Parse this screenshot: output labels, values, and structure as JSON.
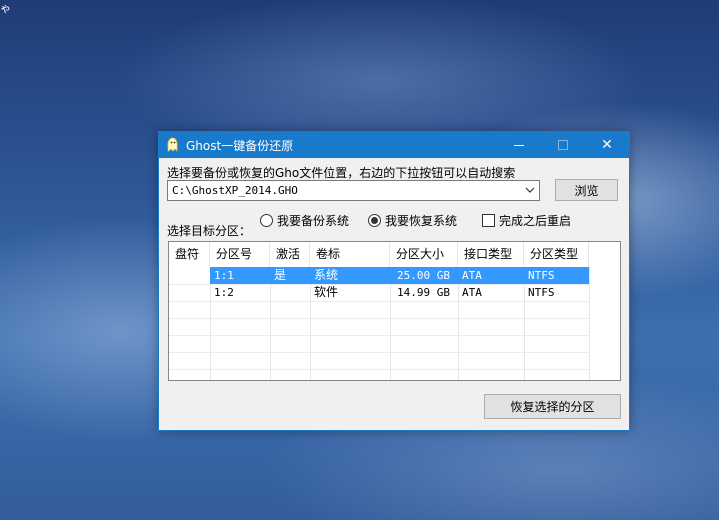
{
  "desktop": {
    "corner_glyph": "ゃ"
  },
  "window": {
    "title": "Ghost一键备份还原",
    "icon": "ghost-app-icon",
    "controls": {
      "minimize": "minimize-icon",
      "maximize": "maximize-icon",
      "close": "close-icon",
      "close_glyph": "✕"
    }
  },
  "path": {
    "label": "选择要备份或恢复的Gho文件位置，右边的下拉按钮可以自动搜索",
    "value": "C:\\GhostXP_2014.GHO",
    "browse_label": "浏览"
  },
  "target": {
    "label": "选择目标分区：",
    "options": [
      {
        "label": "我要备份系统",
        "selected": false
      },
      {
        "label": "我要恢复系统",
        "selected": true
      }
    ],
    "reboot_label": "完成之后重启",
    "reboot_checked": false
  },
  "table": {
    "columns": [
      "盘符",
      "分区号",
      "激活",
      "卷标",
      "分区大小",
      "接口类型",
      "分区类型"
    ],
    "rows": [
      {
        "drive": "",
        "partition": "1:1",
        "active": "是",
        "label": "系统",
        "size": "25.00 GB",
        "interface": "ATA",
        "type": "NTFS",
        "selected": true
      },
      {
        "drive": "",
        "partition": "1:2",
        "active": "",
        "label": "软件",
        "size": "14.99 GB",
        "interface": "ATA",
        "type": "NTFS",
        "selected": false
      }
    ]
  },
  "actions": {
    "restore_label": "恢复选择的分区"
  },
  "colors": {
    "titlebar": "#1979ca",
    "selection": "#3399ff",
    "window_bg": "#f0f0f0"
  }
}
